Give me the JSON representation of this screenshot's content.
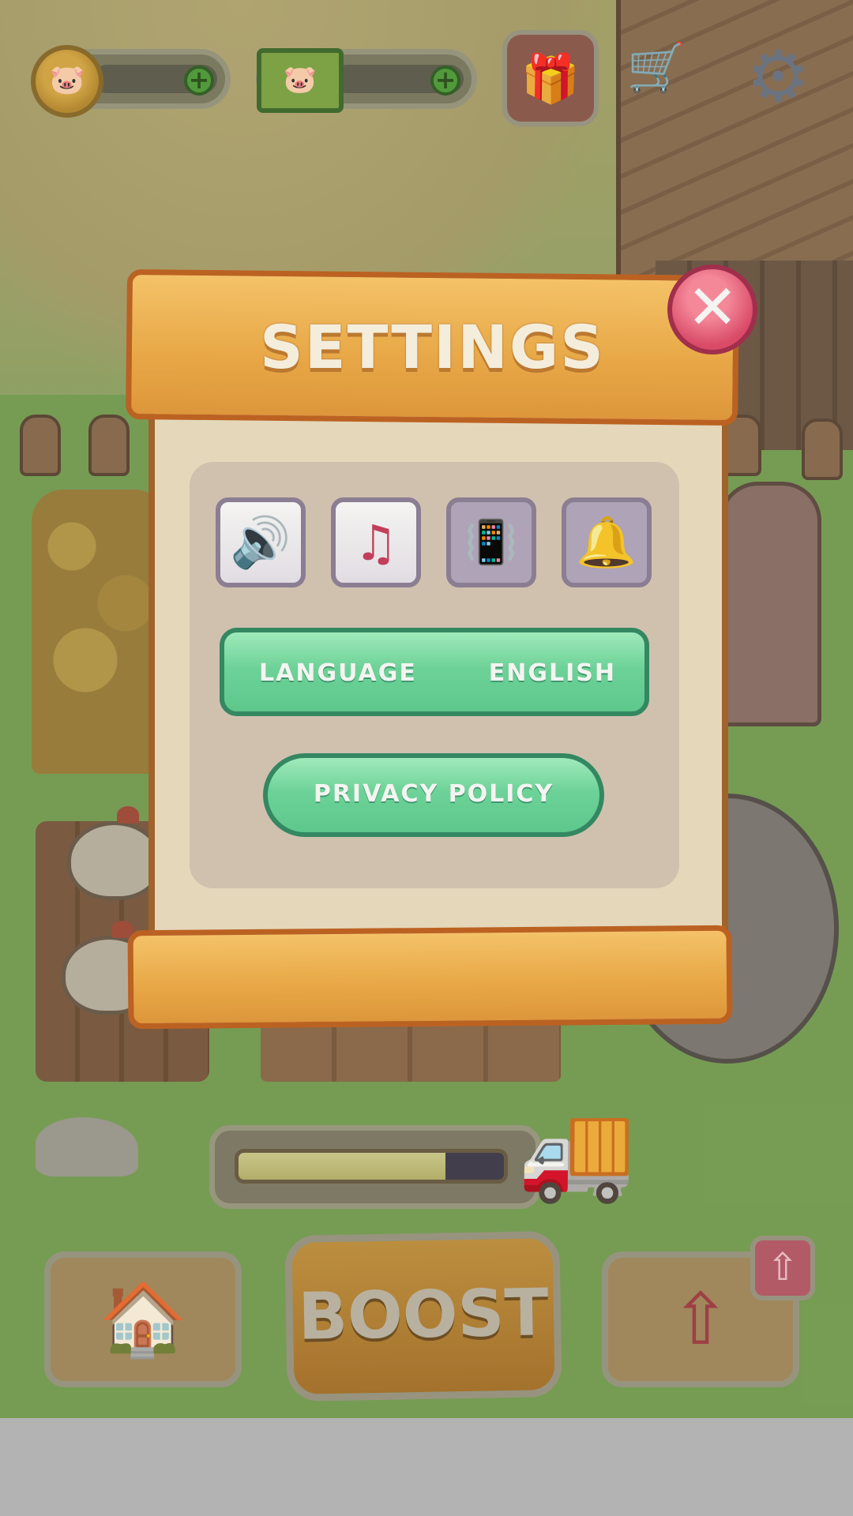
{
  "hud": {
    "coin_icon": "pig-coin-icon",
    "cash_icon": "pig-cash-icon",
    "gift_icon": "gift-icon",
    "shop_icon": "shopping-cart-icon",
    "settings_icon": "gear-icon"
  },
  "dialog": {
    "title": "SETTINGS",
    "close_icon": "close-icon",
    "toggles": [
      {
        "name": "sound",
        "icon": "speaker-icon",
        "state": "on"
      },
      {
        "name": "music",
        "icon": "music-note-icon",
        "state": "on"
      },
      {
        "name": "vibration",
        "icon": "vibration-icon",
        "state": "off"
      },
      {
        "name": "notifications",
        "icon": "bell-icon",
        "state": "off"
      }
    ],
    "language_label": "LANGUAGE",
    "language_value": "ENGLISH",
    "privacy_label": "PRIVACY POLICY"
  },
  "delivery": {
    "progress": 0.78,
    "truck_icon": "delivery-truck-icon"
  },
  "bottom": {
    "home_icon": "house-icon",
    "boost_label": "BOOST",
    "upgrade_icon": "upgrade-arrow-icon",
    "upgrade_badge_icon": "arrow-up-icon"
  },
  "colors": {
    "accent_green": "#6ddb9f",
    "plank_orange": "#f3ae48",
    "close_red": "#e3486b"
  }
}
